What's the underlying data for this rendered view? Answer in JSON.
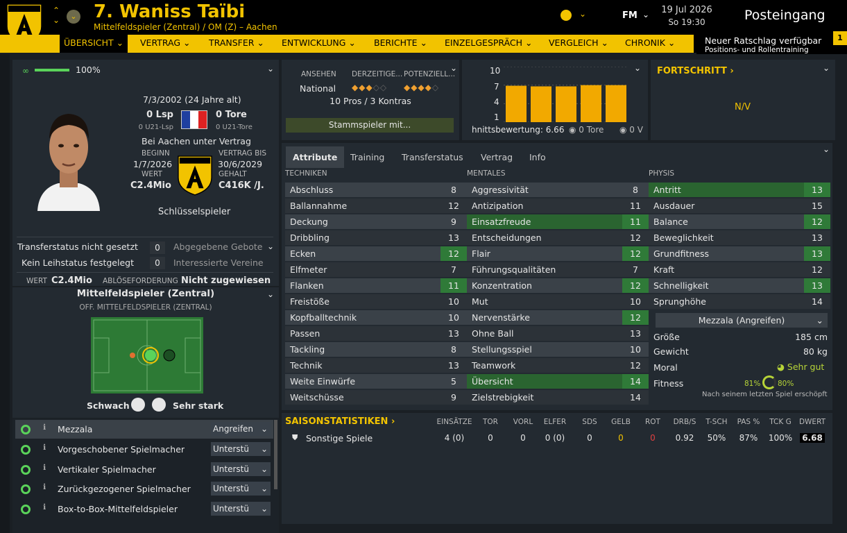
{
  "header": {
    "crest_text": "ALEMANNIA",
    "name": "7. Waniss Taïbi",
    "subtitle": "Mittelfeldspieler (Zentral) / OM (Z) – Aachen",
    "fm": "FM",
    "date": "19 Jul 2026",
    "time": "So 19:30",
    "inbox": "Posteingang"
  },
  "nav": {
    "tabs": [
      "ÜBERSICHT",
      "VERTRAG",
      "TRANSFER",
      "ENTWICKLUNG",
      "BERICHTE",
      "EINZELGESPRÄCH",
      "VERGLEICH",
      "CHRONIK"
    ]
  },
  "advice": {
    "title": "Neuer Ratschlag verfügbar",
    "sub": "Positions- und Rollentraining",
    "count": "1"
  },
  "profile": {
    "fitness_pct": "100%",
    "dob": "7/3/2002 (24 Jahre alt)",
    "lsp": "0 Lsp",
    "tore": "0 Tore",
    "u21lsp": "0 U21-Lsp",
    "u21tore": "0 U21-Tore",
    "contract_text": "Bei Aachen unter Vertrag",
    "beginn_lbl": "BEGINN",
    "beginn": "1/7/2026",
    "bis_lbl": "VERTRAG BIS",
    "bis": "30/6/2029",
    "wert_lbl": "WERT",
    "wert": "C2.4Mio",
    "gehalt_lbl": "GEHALT",
    "gehalt": "C416K /J.",
    "status": "Schlüsselspieler"
  },
  "transfer": {
    "r1l": "Transferstatus nicht gesetzt",
    "r1v": "0",
    "r1r": "Abgegebene Gebote",
    "r2l": "Kein Leihstatus festgelegt",
    "r2v": "0",
    "r2r": "Interessierte Vereine",
    "wert_lbl": "WERT",
    "wert": "C2.4Mio",
    "abl_lbl": "ABLÖSEFORDERUNG",
    "abl": "Nicht zugewiesen"
  },
  "position": {
    "title": "Mittelfeldspieler (Zentral)",
    "sub": "OFF. MITTELFELDSPIELER (ZENTRAL)",
    "weak": "Schwach",
    "strong": "Sehr stark"
  },
  "roles": [
    {
      "name": "Mezzala",
      "duty": "Angreifen"
    },
    {
      "name": "Vorgeschobener Spielmacher",
      "duty": "Unterstü"
    },
    {
      "name": "Vertikaler Spielmacher",
      "duty": "Unterstü"
    },
    {
      "name": "Zurückgezogener Spielmacher",
      "duty": "Unterstü"
    },
    {
      "name": "Box-to-Box-Mittelfeldspieler",
      "duty": "Unterstü"
    }
  ],
  "reputation": {
    "h1": "ANSEHEN",
    "h2": "DERZEITIGE...",
    "h3": "POTENZIELL...",
    "level": "National",
    "proscons": "10 Pros / 3 Kontras",
    "button": "Stammspieler mit..."
  },
  "form_chart": {
    "yticks": [
      "10",
      "7",
      "4",
      "1"
    ],
    "caption": "hnittsbewertung: 6.66",
    "tore": "0 Tore",
    "v": "0 V"
  },
  "chart_data": {
    "type": "bar",
    "categories": [
      "1",
      "2",
      "3",
      "4",
      "5"
    ],
    "values": [
      6.9,
      6.8,
      6.8,
      7.0,
      7.0
    ],
    "ylim": [
      1,
      10
    ],
    "ylabel": "",
    "xlabel": "",
    "color": "#f2a900"
  },
  "progress": {
    "title": "FORTSCHRITT",
    "value": "N/V"
  },
  "tabs2": [
    "Attribute",
    "Training",
    "Transferstatus",
    "Vertrag",
    "Info"
  ],
  "attributes": {
    "tech_title": "TECHNIKEN",
    "ment_title": "MENTALES",
    "phys_title": "PHYSIS",
    "technik": [
      [
        "Abschluss",
        "8"
      ],
      [
        "Ballannahme",
        "12"
      ],
      [
        "Deckung",
        "9"
      ],
      [
        "Dribbling",
        "13"
      ],
      [
        "Ecken",
        "12"
      ],
      [
        "Elfmeter",
        "7"
      ],
      [
        "Flanken",
        "11"
      ],
      [
        "Freistöße",
        "10"
      ],
      [
        "Kopfballtechnik",
        "10"
      ],
      [
        "Passen",
        "13"
      ],
      [
        "Tackling",
        "8"
      ],
      [
        "Technik",
        "13"
      ],
      [
        "Weite Einwürfe",
        "5"
      ],
      [
        "Weitschüsse",
        "9"
      ]
    ],
    "mental": [
      [
        "Aggressivität",
        "8"
      ],
      [
        "Antizipation",
        "11"
      ],
      [
        "Einsatzfreude",
        "11"
      ],
      [
        "Entscheidungen",
        "12"
      ],
      [
        "Flair",
        "12"
      ],
      [
        "Führungsqualitäten",
        "7"
      ],
      [
        "Konzentration",
        "12"
      ],
      [
        "Mut",
        "10"
      ],
      [
        "Nervenstärke",
        "12"
      ],
      [
        "Ohne Ball",
        "13"
      ],
      [
        "Stellungsspiel",
        "10"
      ],
      [
        "Teamwork",
        "12"
      ],
      [
        "Übersicht",
        "14"
      ],
      [
        "Zielstrebigkeit",
        "14"
      ]
    ],
    "physis": [
      [
        "Antritt",
        "13"
      ],
      [
        "Ausdauer",
        "15"
      ],
      [
        "Balance",
        "12"
      ],
      [
        "Beweglichkeit",
        "13"
      ],
      [
        "Grundfitness",
        "13"
      ],
      [
        "Kraft",
        "12"
      ],
      [
        "Schnelligkeit",
        "13"
      ],
      [
        "Sprunghöhe",
        "14"
      ]
    ]
  },
  "physical_info": {
    "role_select": "Mezzala (Angreifen)",
    "groesse_l": "Größe",
    "groesse": "185 cm",
    "gewicht_l": "Gewicht",
    "gewicht": "80 kg",
    "moral_l": "Moral",
    "moral": "Sehr gut",
    "fitness_l": "Fitness",
    "fit1": "81%",
    "fit2": "80%",
    "note": "Nach seinem letzten Spiel erschöpft"
  },
  "season": {
    "title": "SAISONSTATISTIKEN",
    "heads": [
      "EINSÄTZE",
      "TOR",
      "VORL",
      "ELFER",
      "SDS",
      "GELB",
      "ROT",
      "DRB/S",
      "T-SCH",
      "PAS %",
      "TCK G",
      "DWERT"
    ],
    "row_label": "Sonstige Spiele",
    "values": [
      "4 (0)",
      "0",
      "0",
      "0 (0)",
      "0",
      "0",
      "0",
      "0.92",
      "50%",
      "87%",
      "100%",
      "6.68"
    ]
  }
}
